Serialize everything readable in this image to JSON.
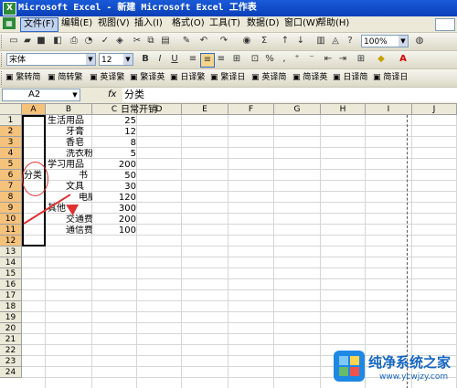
{
  "window": {
    "title": "Microsoft Excel - 新建 Microsoft Excel 工作表",
    "app_icon": "excel-x-icon"
  },
  "menu": {
    "items": [
      "文件(F)",
      "编辑(E)",
      "视图(V)",
      "插入(I)",
      "格式(O)",
      "工具(T)",
      "数据(D)",
      "窗口(W)",
      "帮助(H)"
    ],
    "active_index": 0
  },
  "toolbar": {
    "zoom": "100%",
    "font_name": "宋体",
    "font_size": "12"
  },
  "chinese_toolbar": {
    "buttons": [
      "繁转简",
      "简转繁",
      "英译繁",
      "繁译英",
      "日译繁",
      "繁译日",
      "英译简",
      "简译英",
      "日译简",
      "简译日"
    ]
  },
  "formula_bar": {
    "cell_ref": "A2",
    "fx": "fx",
    "content": "分类"
  },
  "sheet": {
    "columns": [
      "A",
      "B",
      "C",
      "D",
      "E",
      "F",
      "G",
      "H",
      "I",
      "J"
    ],
    "rows": [
      "1",
      "2",
      "3",
      "4",
      "5",
      "6",
      "7",
      "8",
      "9",
      "10",
      "11",
      "12",
      "13",
      "14",
      "15",
      "16",
      "17",
      "18",
      "19",
      "20",
      "21",
      "22",
      "23",
      "24"
    ],
    "title": "日常开销",
    "a_label": "分类",
    "categories": [
      {
        "name": "生活用品",
        "value": "25"
      },
      {
        "name": "牙膏",
        "value": "12"
      },
      {
        "name": "香皂",
        "value": "8"
      },
      {
        "name": "洗衣粉",
        "value": "5"
      },
      {
        "name": "学习用品",
        "value": "200"
      },
      {
        "name": "书",
        "value": "50"
      },
      {
        "name": "文具",
        "value": "30"
      },
      {
        "name": "电脑器",
        "value": "120"
      },
      {
        "name": "其他",
        "value": "300"
      },
      {
        "name": "交通费",
        "value": "200"
      },
      {
        "name": "通信费",
        "value": "100"
      }
    ]
  },
  "watermark": {
    "title": "纯净系统之家",
    "url": "www.ycwjzy.com"
  },
  "colors": {
    "titlebar": "#0a3fb8",
    "annotation": "#e03030",
    "menubar": "#ece9d8"
  }
}
